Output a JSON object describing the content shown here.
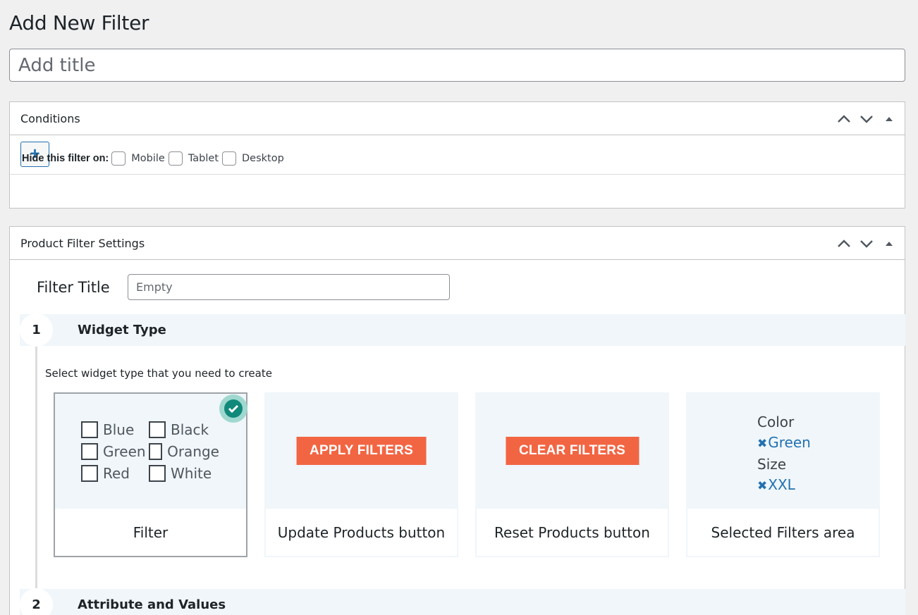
{
  "page": {
    "title": "Add New Filter",
    "title_placeholder": "Add title"
  },
  "conditions": {
    "header": "Conditions",
    "add_button": "+",
    "hide_label": "Hide this filter on:",
    "devices": [
      "Mobile",
      "Tablet",
      "Desktop"
    ]
  },
  "settings": {
    "header": "Product Filter Settings",
    "filter_title_label": "Filter Title",
    "filter_title_placeholder": "Empty",
    "steps": [
      {
        "number": "1",
        "title": "Widget Type"
      },
      {
        "number": "2",
        "title": "Attribute and Values"
      }
    ],
    "select_hint": "Select widget type that you need to create",
    "widget_types": [
      {
        "label": "Filter",
        "selected": true,
        "preview_options": [
          "Blue",
          "Black",
          "Green",
          "Orange",
          "Red",
          "White"
        ]
      },
      {
        "label": "Update Products button",
        "selected": false,
        "preview_button": "APPLY FILTERS"
      },
      {
        "label": "Reset Products button",
        "selected": false,
        "preview_button": "CLEAR FILTERS"
      },
      {
        "label": "Selected Filters area",
        "selected": false,
        "preview_groups": [
          {
            "name": "Color",
            "value": "Green"
          },
          {
            "name": "Size",
            "value": "XXL"
          }
        ]
      }
    ]
  },
  "icons": {
    "move_up": "chevron-up-icon",
    "move_down": "chevron-down-icon",
    "toggle": "triangle-up-icon",
    "selected": "check-icon",
    "remove": "x-icon"
  },
  "colors": {
    "accent": "#2271b1",
    "button_orange": "#f26543",
    "check_green": "#10897b",
    "step_bg": "#f0f6fa"
  }
}
